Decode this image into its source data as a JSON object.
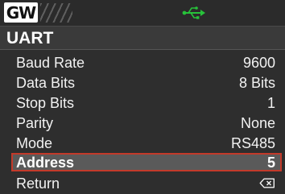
{
  "header": {
    "logo_text": "GW",
    "usb_icon": "usb-connected-icon",
    "usb_color": "#27c23a"
  },
  "page": {
    "title": "UART"
  },
  "menu": {
    "items": [
      {
        "label": "Baud Rate",
        "value": "9600"
      },
      {
        "label": "Data Bits",
        "value": "8 Bits"
      },
      {
        "label": "Stop Bits",
        "value": "1"
      },
      {
        "label": "Parity",
        "value": "None"
      },
      {
        "label": "Mode",
        "value": "RS485"
      },
      {
        "label": "Address",
        "value": "5",
        "selected": true
      },
      {
        "label": "Return",
        "icon": "return-icon"
      }
    ]
  },
  "colors": {
    "selection_border": "#c33a2a",
    "selection_fill": "#5a5a5a",
    "background": "#2e2e2e"
  }
}
